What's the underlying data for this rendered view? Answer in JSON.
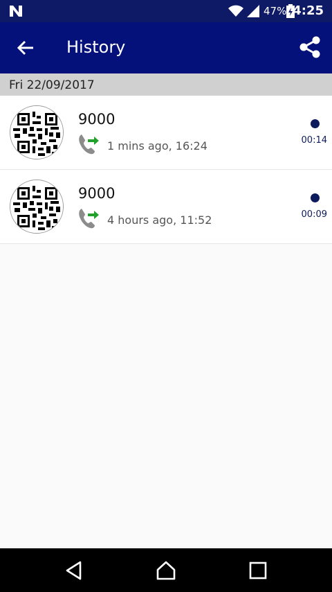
{
  "status_bar": {
    "battery_pct": "47%",
    "clock": "4:25",
    "icons": [
      "n-notification-icon",
      "wifi-icon",
      "signal-icon",
      "battery-icon"
    ]
  },
  "app_bar": {
    "title": "History",
    "icons": [
      "back-arrow-icon",
      "share-icon"
    ]
  },
  "history": {
    "date_header": "Fri 22/09/2017",
    "entries": [
      {
        "name": "9000",
        "time": "1 mins ago, 16:24",
        "duration": "00:14",
        "direction": "outgoing-call-icon"
      },
      {
        "name": "9000",
        "time": "4 hours ago, 11:52",
        "duration": "00:09",
        "direction": "outgoing-call-icon"
      }
    ]
  },
  "nav_bar": {
    "icons": [
      "nav-back-icon",
      "nav-home-icon",
      "nav-recents-icon"
    ]
  },
  "colors": {
    "status_bar": "#0f1a66",
    "app_bar": "#05117a",
    "date_header": "#d0d0d0",
    "accent_dot": "#0d1a5c",
    "call_arrow": "#22a02c"
  }
}
